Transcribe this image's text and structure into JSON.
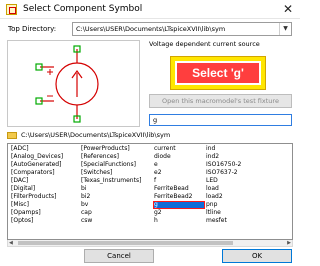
{
  "window": {
    "title": "Select Component Symbol",
    "close_glyph": "✕"
  },
  "top_directory": {
    "label": "Top Directory:",
    "value": "C:\\Users\\USER\\Documents\\LTspiceXVII\\lib\\sym",
    "arrow": "▼"
  },
  "preview": {
    "symbol": "current-source-icon",
    "pin_color": "#00aa00",
    "symbol_color": "#d40000"
  },
  "description": "Voltage dependent current source",
  "callout": {
    "text": "Select 'g'",
    "outer_color": "#ffe600",
    "inner_color": "#ff3e3e"
  },
  "testfixture_button": "Open this macromodel's test fixture",
  "name_input": {
    "value": "g"
  },
  "current_path": "C:\\Users\\USER\\Documents\\LTspiceXVII\\lib\\sym",
  "list": {
    "selected": "g",
    "columns": [
      [
        "[ADC]",
        "[Analog_Devices]",
        "[AutoGenerated]",
        "[Comparators]",
        "[DAC]",
        "[Digital]",
        "[FilterProducts]",
        "[Misc]",
        "[Opamps]",
        "[Optos]"
      ],
      [
        "[PowerProducts]",
        "[References]",
        "[SpecialFunctions]",
        "[Switches]",
        "[Texas_Instruments]",
        "bi",
        "bi2",
        "bv",
        "cap",
        "csw"
      ],
      [
        "current",
        "diode",
        "e",
        "e2",
        "f",
        "FerriteBead",
        "FerriteBead2",
        "g",
        "g2",
        "h"
      ],
      [
        "ind",
        "ind2",
        "ISO16750-2",
        "ISO7637-2",
        "LED",
        "load",
        "load2",
        "pnp",
        "ltline",
        "mesfet"
      ]
    ]
  },
  "scroll": {
    "left": "◀",
    "right": "▶"
  },
  "buttons": {
    "cancel": "Cancel",
    "ok": "OK"
  }
}
